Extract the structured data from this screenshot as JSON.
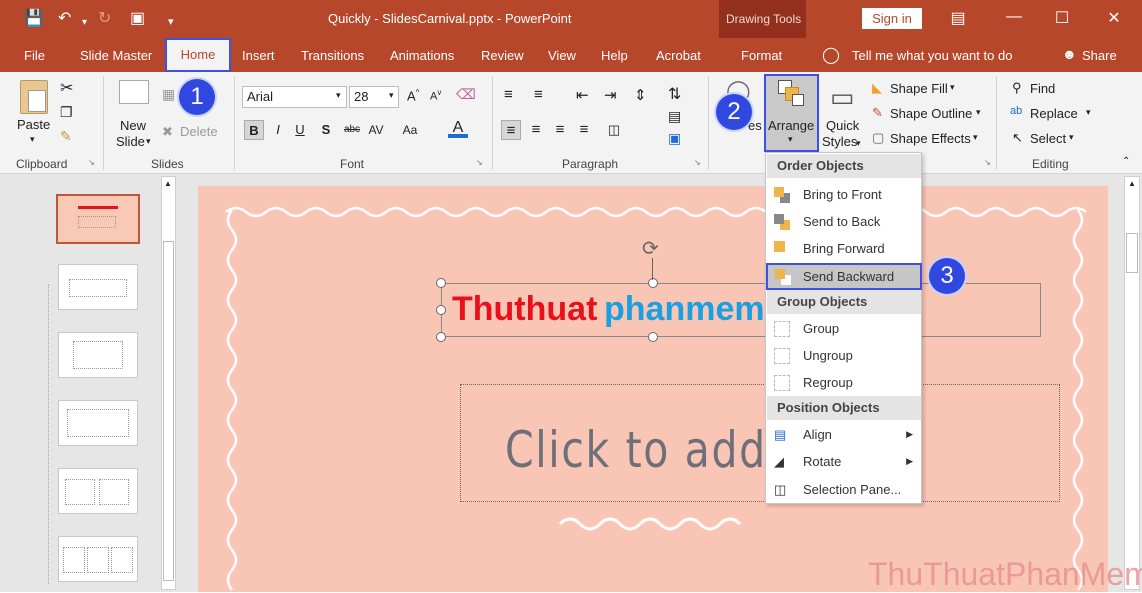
{
  "window": {
    "title": "Quickly - SlidesCarnival.pptx  -  PowerPoint",
    "context_tab_group": "Drawing Tools",
    "sign_in": "Sign in"
  },
  "tabs": [
    "File",
    "Slide Master",
    "Home",
    "Insert",
    "Transitions",
    "Animations",
    "Review",
    "View",
    "Help",
    "Acrobat",
    "Format"
  ],
  "tell_me": "Tell me what you want to do",
  "share": "Share",
  "ribbon": {
    "clipboard": {
      "label": "Clipboard",
      "paste": "Paste"
    },
    "slides": {
      "label": "Slides",
      "new_slide_1": "New",
      "new_slide_2": "Slide",
      "delete": "Delete"
    },
    "font": {
      "label": "Font",
      "name": "Arial",
      "size": "28"
    },
    "paragraph": {
      "label": "Paragraph"
    },
    "drawing": {
      "arrange": "Arrange",
      "quick_styles_1": "Quick",
      "quick_styles_2": "Styles",
      "shapes_partial": "es",
      "shape_fill": "Shape Fill",
      "shape_outline": "Shape Outline",
      "shape_effects": "Shape Effects"
    },
    "editing": {
      "label": "Editing",
      "find": "Find",
      "replace": "Replace",
      "select": "Select"
    }
  },
  "dropdown": {
    "order_head": "Order Objects",
    "bring_front": "Bring to Front",
    "send_back": "Send to Back",
    "bring_forward": "Bring Forward",
    "send_backward": "Send Backward",
    "group_head": "Group Objects",
    "group": "Group",
    "ungroup": "Ungroup",
    "regroup": "Regroup",
    "position_head": "Position Objects",
    "align": "Align",
    "rotate": "Rotate",
    "selection_pane": "Selection Pane..."
  },
  "slide": {
    "title_red": "Thuthuat",
    "title_blue": "phanmem",
    "subtitle": "Click to add tit"
  },
  "badges": [
    "1",
    "2",
    "3"
  ],
  "watermark": "ThuThuatPhanMem.vn",
  "colors": {
    "accent": "#b7472a",
    "slide_bg": "#f9c6b6",
    "highlight": "#3f51e0",
    "title_red": "#e8101a",
    "title_blue": "#1aa0e0"
  }
}
